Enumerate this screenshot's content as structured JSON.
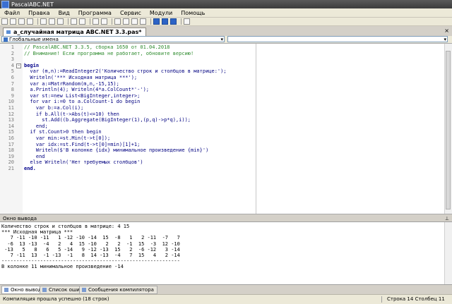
{
  "window": {
    "title": "PascalABC.NET"
  },
  "menu": [
    "Файл",
    "Правка",
    "Вид",
    "Программа",
    "Сервис",
    "Модули",
    "Помощь"
  ],
  "toolbar": {
    "icons": [
      "new-file",
      "open-file",
      "save-file",
      "save-all",
      "sep",
      "cut",
      "copy",
      "paste",
      "sep",
      "undo",
      "redo",
      "sep",
      "run",
      "stop",
      "sep",
      "debug",
      "step-into",
      "step-over",
      "step-out",
      "sep",
      "format",
      "breakpoint",
      "watch",
      "sep",
      "help"
    ]
  },
  "tab": {
    "label": "a_случайная матрица ABC.NET 3.3.pas*",
    "close": "×"
  },
  "combos": {
    "left": "Глобальные имена",
    "right": ""
  },
  "code": [
    {
      "n": "1",
      "t": "// PascalABC.NET 3.3.5, сборка 1650 от 01.04.2018",
      "c": "#2e8b2e"
    },
    {
      "n": "2",
      "t": "// Внимание! Если программа не работает, обновите версию!",
      "c": "#2e8b2e"
    },
    {
      "n": "3",
      "t": "",
      "c": "#000"
    },
    {
      "n": "4",
      "t": "begin",
      "c": "#00008b",
      "b": true,
      "fold": true
    },
    {
      "n": "5",
      "t": "  var (m,n):=ReadInteger2('Количество строк и столбцов в матрице:');",
      "c": "#000080"
    },
    {
      "n": "6",
      "t": "  Writeln('*** Исходная матрица ***');",
      "c": "#000080"
    },
    {
      "n": "7",
      "t": "  var a:=MatrRandom(m,n,-15,15);",
      "c": "#000080"
    },
    {
      "n": "8",
      "t": "  a.Println(4); Writeln(4*a.ColCount*'-');",
      "c": "#000080"
    },
    {
      "n": "9",
      "t": "  var st:=new List<BigInteger,integer>;",
      "c": "#000080"
    },
    {
      "n": "10",
      "t": "  for var i:=0 to a.ColCount-1 do begin",
      "c": "#000080"
    },
    {
      "n": "11",
      "t": "    var b:=a.Col(i);",
      "c": "#000080"
    },
    {
      "n": "12",
      "t": "    if b.All(t->Abs(t)<=10) then",
      "c": "#000080"
    },
    {
      "n": "13",
      "t": "      st.Add((b.Aggregate(BigInteger(1),(p,q)->p*q),i));",
      "c": "#000080"
    },
    {
      "n": "14",
      "t": "    end;",
      "c": "#000080"
    },
    {
      "n": "15",
      "t": "  if st.Count>0 then begin",
      "c": "#000080"
    },
    {
      "n": "16",
      "t": "    var min:=st.Min(t->t[0]);",
      "c": "#000080"
    },
    {
      "n": "17",
      "t": "    var idx:=st.Find(t->t[0]=min)[1]+1;",
      "c": "#000080"
    },
    {
      "n": "18",
      "t": "    Writeln($'В колонке {idx} минимальное произведение {min}')",
      "c": "#000080"
    },
    {
      "n": "19",
      "t": "    end",
      "c": "#000080"
    },
    {
      "n": "20",
      "t": "  else Writeln('Нет требуемых столбцов')",
      "c": "#000080"
    },
    {
      "n": "21",
      "t": "end.",
      "c": "#00008b",
      "b": true
    }
  ],
  "output_panel": {
    "title": "Окно вывода",
    "pin": "⊥",
    "lines": [
      "Количество строк и столбцов в матрице: 4 15",
      "*** Исходная матрица ***",
      "   7 -11 -10 -11   1 -12 -10 -14  15  -8   1   2 -11  -7   7",
      "  -6  13 -13  -4   2   4  15 -10   2   2  -1  15  -3  12 -10",
      " -13   5   8   6   5 -14   9 -12 -13  15   2  -6 -12   3 -14",
      "   7 -11  13  -1 -13  -1   8  14 -13  -4   7  15   4   2 -14",
      "------------------------------------------------------------",
      "В колонке 11 минимальное произведение -14"
    ]
  },
  "bottom_tabs": [
    "Окно вывода",
    "Список ошибок",
    "Сообщения компилятора"
  ],
  "status": {
    "message": "Компиляция прошла успешно (18 строк)",
    "position": "Строка  14  Столбец  11"
  }
}
